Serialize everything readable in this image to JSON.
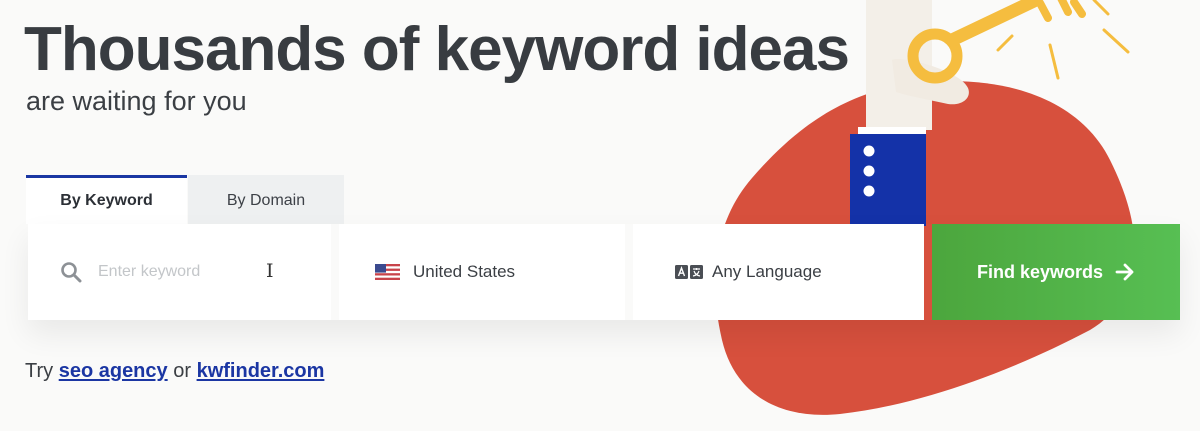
{
  "hero": {
    "headline": "Thousands of keyword ideas",
    "subheadline": "are waiting for you"
  },
  "tabs": [
    {
      "label": "By Keyword",
      "active": true
    },
    {
      "label": "By Domain",
      "active": false
    }
  ],
  "search": {
    "keyword_placeholder": "Enter keyword",
    "keyword_value": "",
    "location": "United States",
    "language": "Any Language",
    "submit_label": "Find keywords"
  },
  "suggestions": {
    "prefix": "Try",
    "link1": "seo agency",
    "connector": "or",
    "link2": "kwfinder.com"
  },
  "colors": {
    "tab_active_border": "#1a37a3",
    "button_green": "#4ca63d",
    "link_blue": "#1b36a3",
    "blob_red": "#d7503d",
    "sleeve_blue": "#1432a8",
    "key_yellow": "#f5bd3f"
  },
  "icons": [
    "search-icon",
    "us-flag-icon",
    "language-icon",
    "arrow-right-icon",
    "key-icon",
    "text-cursor-icon"
  ]
}
